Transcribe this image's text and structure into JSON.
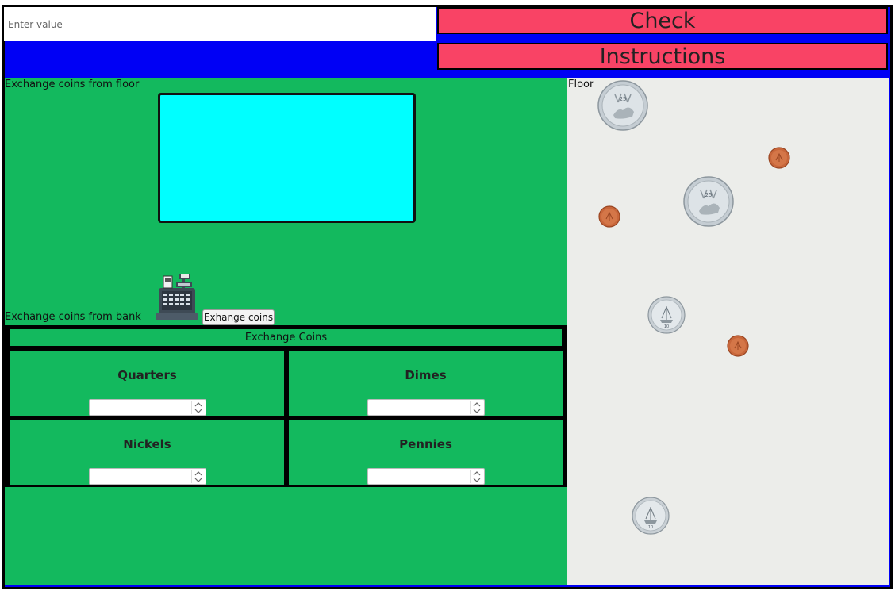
{
  "input": {
    "placeholder": "Enter value"
  },
  "buttons": {
    "check": "Check",
    "instructions": "Instructions",
    "exchange": "Exhange coins"
  },
  "labels": {
    "from_floor": "Exchange coins from floor",
    "from_bank": "Exchange coins from bank",
    "floor": "Floor",
    "exchange_header": "Exchange Coins"
  },
  "exchange": {
    "quarters": "Quarters",
    "dimes": "Dimes",
    "nickels": "Nickels",
    "pennies": "Pennies"
  },
  "coins": {
    "quarter_text": "25",
    "dime_text": "10",
    "country": "CANADA"
  },
  "colors": {
    "frame_blue": "#0000f5",
    "button_red": "#f94365",
    "panel_green": "#13b95e",
    "drop_cyan": "#00ffff",
    "floor_gray": "#ecedea"
  }
}
